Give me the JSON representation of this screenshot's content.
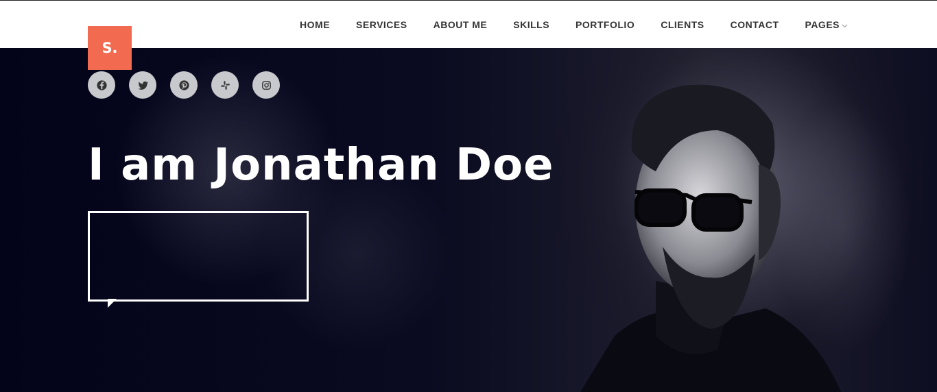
{
  "logo": {
    "text": "S.",
    "color": "#f26b50"
  },
  "nav": {
    "items": [
      {
        "label": "HOME"
      },
      {
        "label": "SERVICES"
      },
      {
        "label": "ABOUT ME"
      },
      {
        "label": "SKILLS"
      },
      {
        "label": "PORTFOLIO"
      },
      {
        "label": "CLIENTS"
      },
      {
        "label": "CONTACT"
      },
      {
        "label": "PAGES",
        "dropdown": true,
        "icon": "chevron-down-icon"
      }
    ]
  },
  "social": [
    {
      "name": "facebook",
      "icon": "facebook-icon"
    },
    {
      "name": "twitter",
      "icon": "twitter-icon"
    },
    {
      "name": "pinterest",
      "icon": "pinterest-icon"
    },
    {
      "name": "slack",
      "icon": "slack-icon"
    },
    {
      "name": "instagram",
      "icon": "instagram-icon"
    }
  ],
  "hero": {
    "headline": "I am Jonathan Doe",
    "speech_bubble_text": ""
  },
  "colors": {
    "accent": "#f26b50",
    "hero_bg": "#05051a",
    "social_bg": "#c8c9cd"
  }
}
